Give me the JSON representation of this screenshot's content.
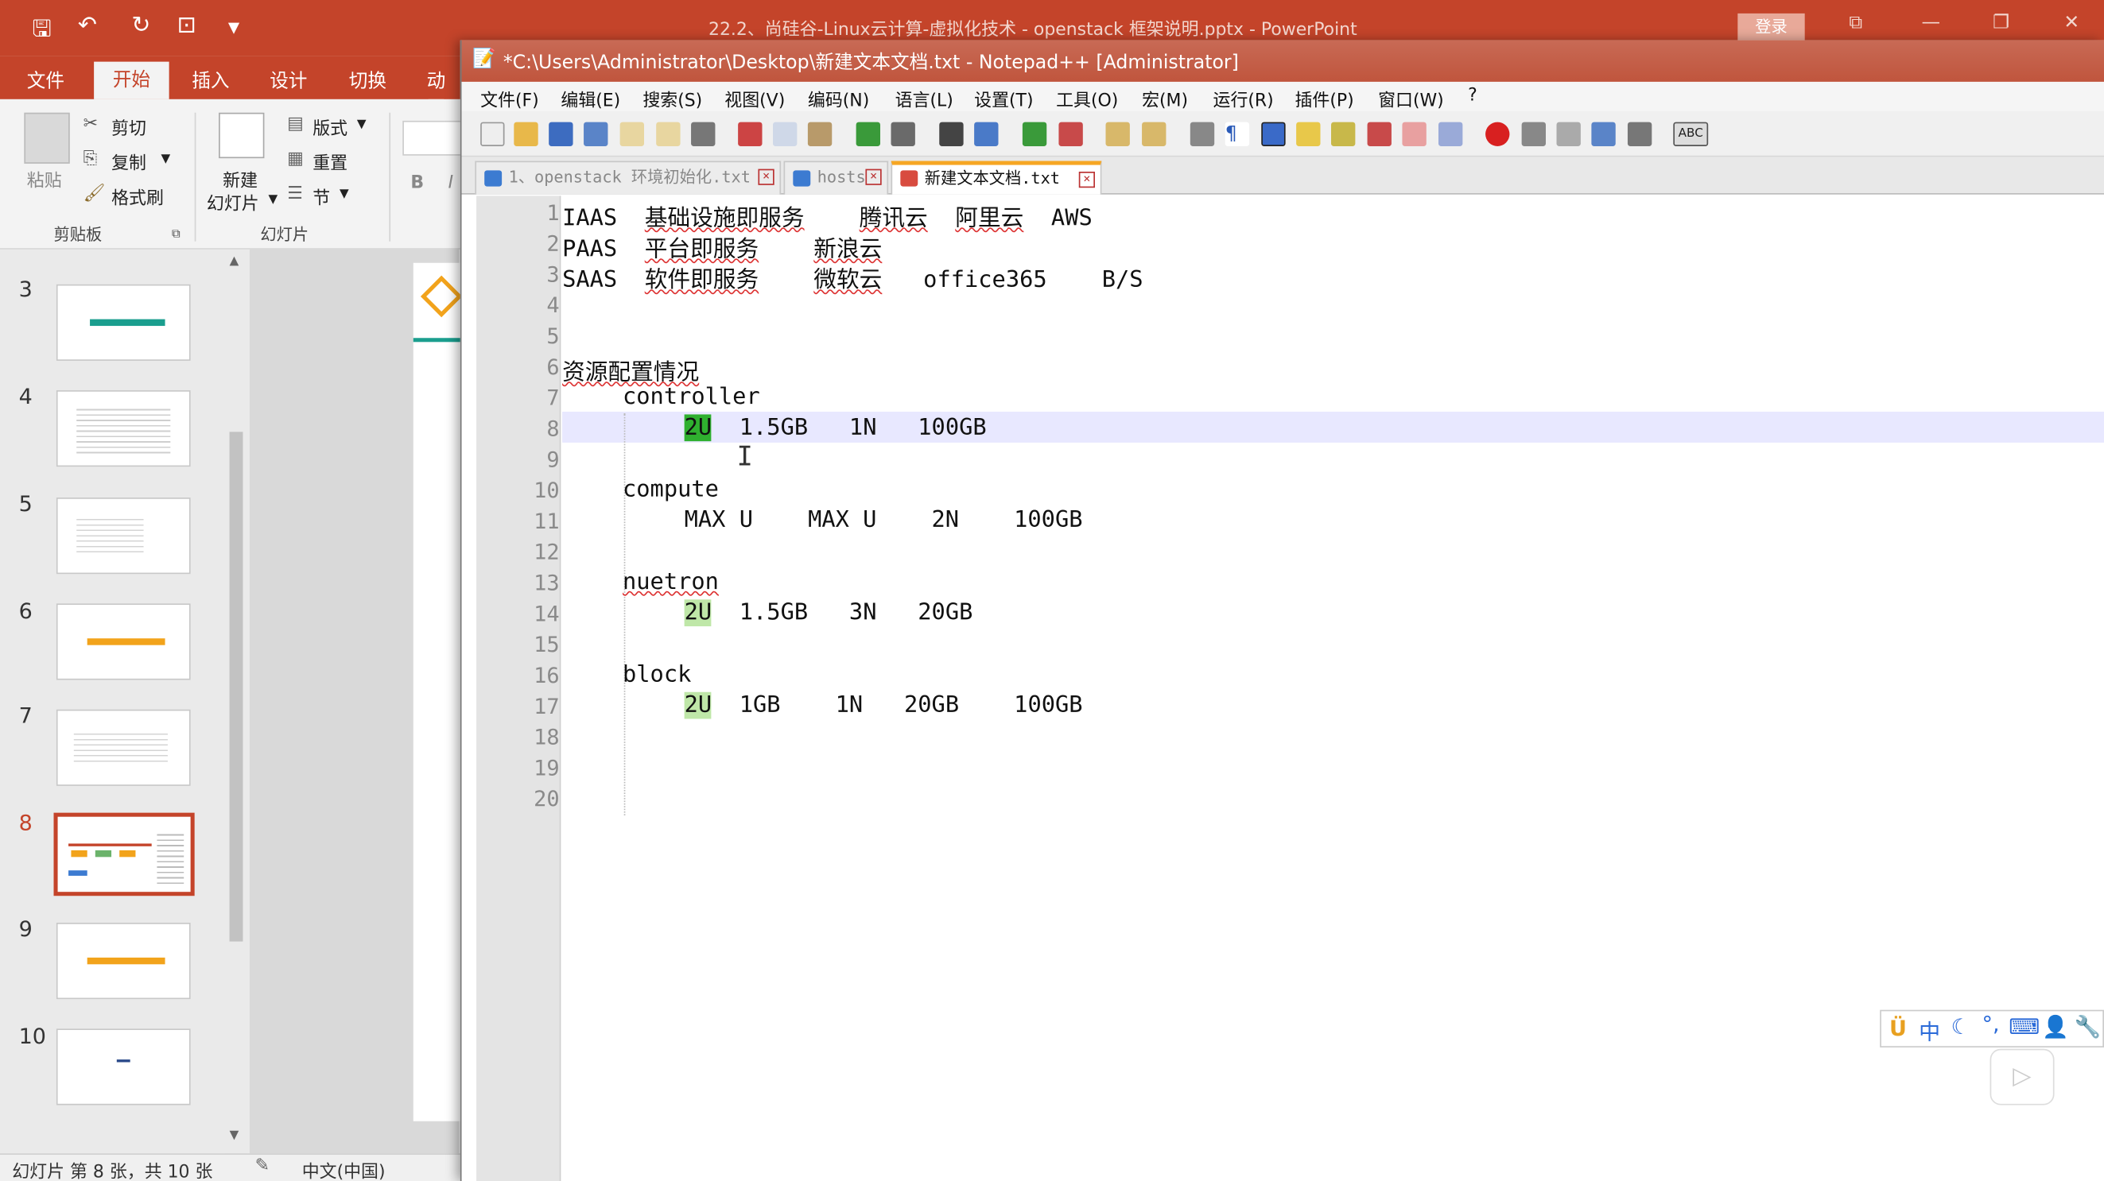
{
  "powerpoint": {
    "title": "22.2、尚硅谷-Linux云计算-虚拟化技术 - openstack 框架说明.pptx  -  PowerPoint",
    "login_label": "登录",
    "tabs": [
      "文件",
      "开始",
      "插入",
      "设计",
      "切换",
      "动画"
    ],
    "ribbon": {
      "paste": "粘贴",
      "cut": "剪切",
      "copy": "复制",
      "format_painter": "格式刷",
      "clipboard_group": "剪贴板",
      "new_slide": [
        "新建",
        "幻灯片"
      ],
      "layout": "版式",
      "reset": "重置",
      "section": "节",
      "slides_group": "幻灯片"
    },
    "slide_numbers": [
      "3",
      "4",
      "5",
      "6",
      "7",
      "8",
      "9",
      "10"
    ],
    "selected_slide": "8",
    "status": {
      "slide_info": "幻灯片 第 8 张，共 10 张",
      "language": "中文(中国)"
    }
  },
  "notepad": {
    "title": "*C:\\Users\\Administrator\\Desktop\\新建文本文档.txt - Notepad++ [Administrator]",
    "menu": [
      "文件(F)",
      "编辑(E)",
      "搜索(S)",
      "视图(V)",
      "编码(N)",
      "语言(L)",
      "设置(T)",
      "工具(O)",
      "宏(M)",
      "运行(R)",
      "插件(P)",
      "窗口(W)",
      "?"
    ],
    "file_tabs": [
      {
        "label": "1、openstack 环境初始化.txt",
        "active": false
      },
      {
        "label": "hosts",
        "active": false
      },
      {
        "label": "新建文本文档.txt",
        "active": true
      }
    ],
    "line_numbers": [
      "1",
      "2",
      "3",
      "4",
      "5",
      "6",
      "7",
      "8",
      "9",
      "10",
      "11",
      "12",
      "13",
      "14",
      "15",
      "16",
      "17",
      "18",
      "19",
      "20"
    ],
    "lines": {
      "l1": {
        "a": "IAAS",
        "b": "基础设施即服务",
        "c": "腾讯云",
        "d": "阿里云",
        "e": "AWS"
      },
      "l2": {
        "a": "PAAS",
        "b": "平台即服务",
        "c": "新浪云"
      },
      "l3": {
        "a": "SAAS",
        "b": "软件即服务",
        "c": "微软云",
        "d": "office365",
        "e": "B/S"
      },
      "l6": "资源配置情况",
      "l7": "controller",
      "l8": {
        "a": "2U",
        "b": "1.5GB   1N   100GB"
      },
      "l10": "compute",
      "l11": "MAX U    MAX U    2N    100GB",
      "l13": "nuetron",
      "l14": {
        "a": "2U",
        "b": "1.5GB   3N   20GB"
      },
      "l16": "block",
      "l17": {
        "a": "2U",
        "b": "1GB    1N   20GB    100GB"
      }
    }
  },
  "ime": {
    "mode": "中"
  },
  "colors": {
    "pp_accent": "#c4442a",
    "np_highlight": "#2fb02f",
    "current_line": "#e8e8ff"
  }
}
